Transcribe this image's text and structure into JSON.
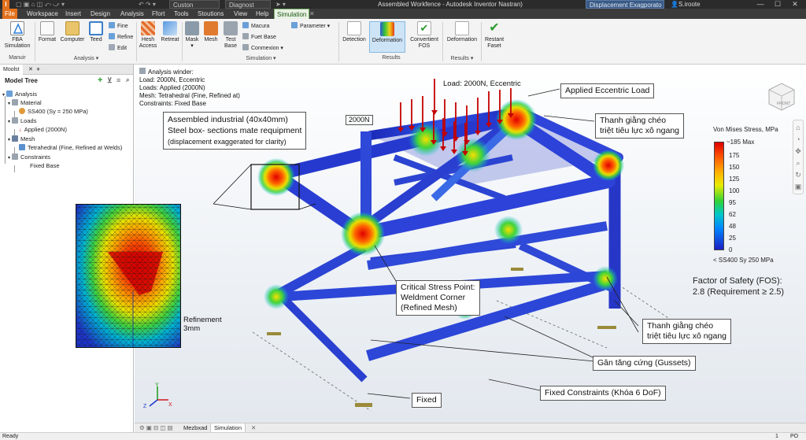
{
  "titlebar": {
    "app_icon": "I",
    "combo_style": "Custon",
    "combo_analysis": "Diagnost",
    "title": "Assembled Workfence - Autodesk Inventor Nastran)",
    "combo_display": "Displacement Exagporato",
    "user": "S.iroote"
  },
  "menubar": {
    "items": [
      "File",
      "Workspace",
      "Insert",
      "Design",
      "Analysis",
      "Ffort",
      "Tools",
      "Stoutions",
      "View",
      "Help",
      "Simulation"
    ],
    "active": "Simulation"
  },
  "ribbon": {
    "fea": "FBA Simulation",
    "manuir": "Manuir",
    "format": "Format",
    "computer": "Computer",
    "teed": "Teed",
    "fine": "Fine",
    "refine": "Refine",
    "edit": "Edit",
    "analysis_group": "Analysis",
    "hesh_access": "Hesh Access",
    "retreat": "Retreat",
    "mask": "Mask",
    "mesh": "Mesh",
    "test_base": "Test Base",
    "macura": "Macura",
    "fuet_base": "Fuet Base",
    "connexion": "Conmexion",
    "parameter": "Parameter",
    "simulation_group": "Simulation",
    "detection": "Detection",
    "deformation": "Deformation",
    "convertient_fos": "Convertient FOS",
    "results_group": "Results",
    "deformation2": "Deformation",
    "results_group2": "Results",
    "restant_faset": "Restant Faset"
  },
  "browser": {
    "tab": "Moolst",
    "title": "Model Tree",
    "tree": {
      "analysis": "Analysis",
      "material": "Material",
      "material_value": "SS400 (Sy = 250 MPa)",
      "loads": "Loads",
      "loads_value": "Applied (2000N)",
      "mesh": "Mesh",
      "mesh_value": "Tetrahedral (Fine, Refined at Welds)",
      "constraints": "Constraints",
      "constraints_value": "Fixed Base"
    }
  },
  "viewport": {
    "info": {
      "line1": "Analysis winder:",
      "line2": "Load:  2000N, Eccentric",
      "line3": "Loads: Applied (2000N)",
      "line4": "Mesh: Tetrahedral (Fine, Refined at)",
      "line5": "Constraints: Fixed Base"
    },
    "heading_box": {
      "line1": "Assembled industrial (40x40mm)",
      "line2": "Steel box- sections mate requipment",
      "line3": "(displacement exaggerated for clarity)"
    },
    "load_label": "Load: 2000N, Eccentric",
    "force_tag": "2000N",
    "applied_load": "Applied Eccentric Load",
    "brace_top": {
      "line1": "Thanh giằng chéo",
      "line2": "triệt tiêu lực xô ngang"
    },
    "brace_right": {
      "line1": "Thanh giằng chéo",
      "line2": "triệt tiêu lực xô ngang"
    },
    "gussets": "Gân tăng cứng (Gussets)",
    "fixed_constraints": "Fixed Constraints (Khóa 6 DoF)",
    "fixed": "Fixed",
    "critical": {
      "line1": "Critical Stress Point:",
      "line2": "Weldment Corner",
      "line3": "(Refined Mesh)"
    },
    "refinement": {
      "line1": "Refinement",
      "line2": "3mm"
    },
    "legend": {
      "title": "Von Mises Stress, MPa",
      "labels": [
        "~185 Max",
        "175",
        "150",
        "125",
        "100",
        "95",
        "62",
        "48",
        "25",
        "0"
      ],
      "footer": "< SS400 Sy 250 MPa"
    },
    "fos": {
      "line1": "Factor of Safety (FOS):",
      "line2": "2.8 (Requirement ≥ 2.5)"
    },
    "viewcube": "FRONT",
    "axes": {
      "x": "X",
      "y": "Y",
      "z": "Z"
    }
  },
  "doctabs": {
    "tab1": "Mezbxad",
    "tab2": "Simulation"
  },
  "status": {
    "left": "Ready",
    "page": "1",
    "right": "PO"
  },
  "colors": {
    "accent": "#e2701c",
    "ribbon_active": "#cde4f7",
    "stress_max": "#e00000",
    "stress_min": "#1b1fc2"
  }
}
